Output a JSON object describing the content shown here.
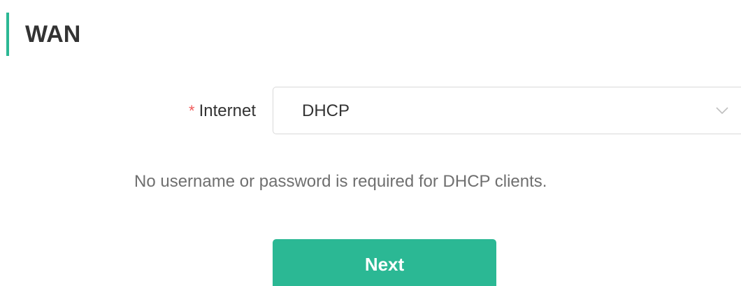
{
  "section": {
    "title": "WAN",
    "accent_color": "#2bb894"
  },
  "form": {
    "internet": {
      "required_mark": "*",
      "label": "Internet",
      "selected_value": "DHCP",
      "dropdown_icon": "chevron-down-icon"
    },
    "help_text": "No username or password is required for DHCP clients."
  },
  "actions": {
    "next_label": "Next",
    "button_color": "#2bb894"
  }
}
